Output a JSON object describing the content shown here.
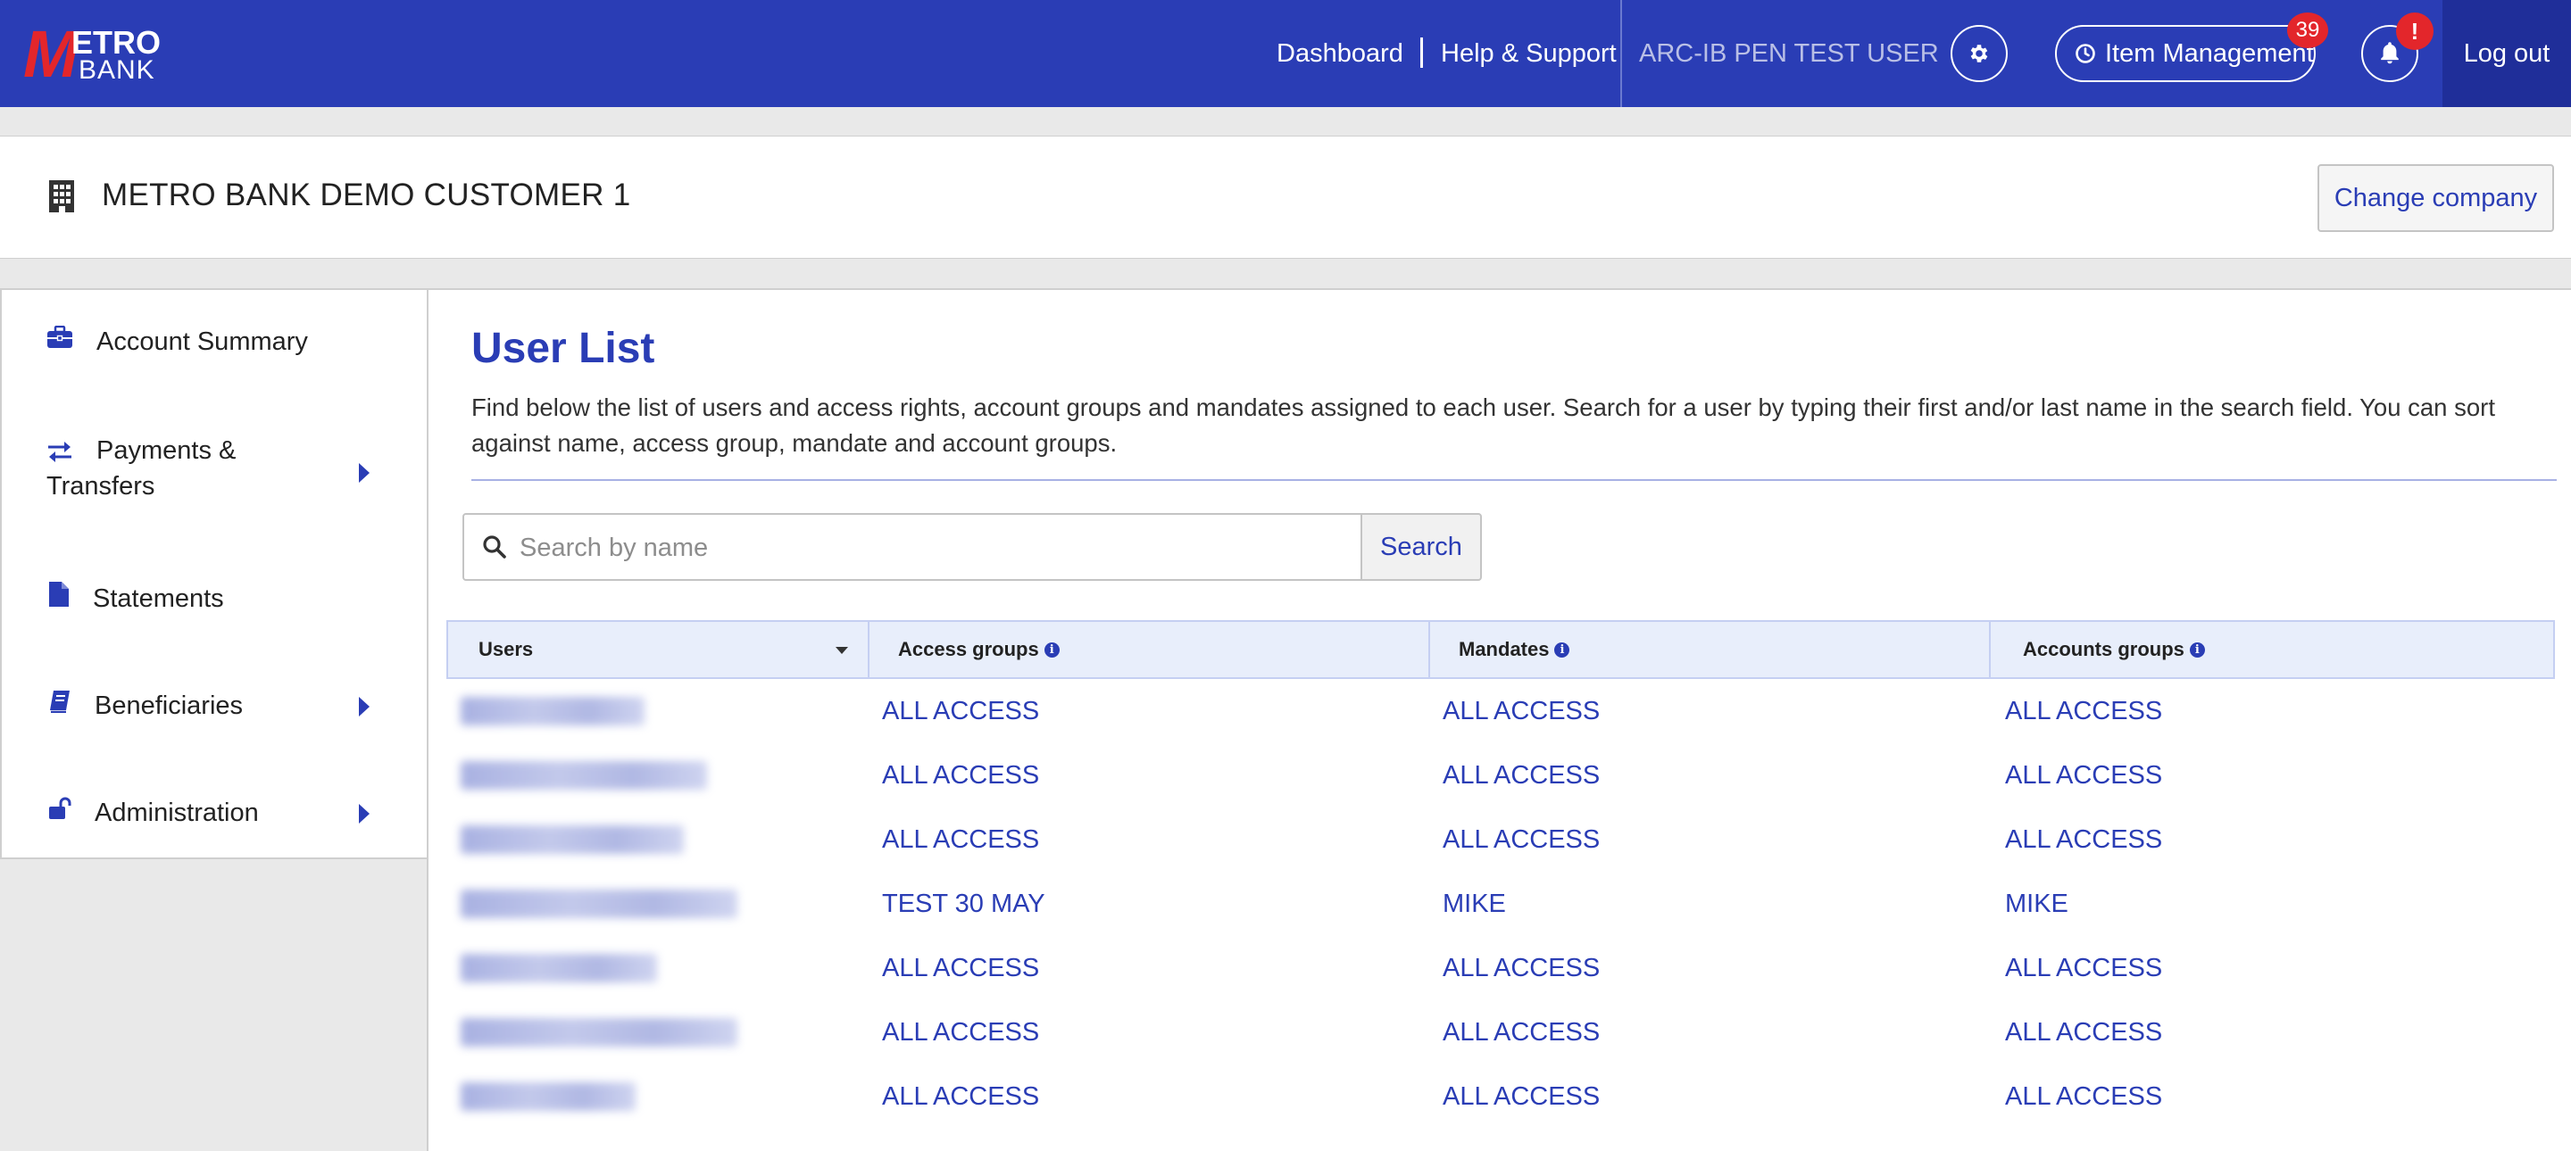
{
  "brand": {
    "logo_m": "M",
    "logo_etro": "ETRO",
    "logo_bank": "BANK",
    "primary_color": "#2a3db5",
    "accent_color": "#e3262b"
  },
  "topnav": {
    "dashboard": "Dashboard",
    "separator": "|",
    "help": "Help & Support",
    "user": "ARC-IB PEN TEST USER",
    "settings_icon": "gear-icon",
    "item_management": "Item Management",
    "item_management_icon": "clock-icon",
    "item_management_count": "39",
    "notifications_icon": "bell-icon",
    "notifications_badge": "!",
    "logout": "Log out"
  },
  "company": {
    "icon": "building-icon",
    "name": "METRO BANK DEMO CUSTOMER 1",
    "change_button": "Change company"
  },
  "sidebar": {
    "items": [
      {
        "label": "Account Summary",
        "icon": "briefcase-icon",
        "has_submenu": false
      },
      {
        "label": "Payments & Transfers",
        "icon": "transfer-arrows-icon",
        "has_submenu": true
      },
      {
        "label": "Statements",
        "icon": "document-icon",
        "has_submenu": false
      },
      {
        "label": "Beneficiaries",
        "icon": "address-book-icon",
        "has_submenu": true
      },
      {
        "label": "Administration",
        "icon": "unlock-icon",
        "has_submenu": true
      }
    ]
  },
  "main": {
    "title": "User List",
    "description": "Find below the list of users and access rights, account groups and mandates assigned to each user. Search for a user by typing their first and/or last name in the search field. You can sort against name, access group, mandate and account groups.",
    "search": {
      "placeholder": "Search by name",
      "value": "",
      "button": "Search",
      "icon": "search-icon"
    },
    "table": {
      "columns": [
        "Users",
        "Access groups",
        "Mandates",
        "Accounts groups"
      ],
      "info_icon": "i",
      "rows": [
        {
          "access": "ALL ACCESS",
          "mandate": "ALL ACCESS",
          "accounts": "ALL ACCESS"
        },
        {
          "access": "ALL ACCESS",
          "mandate": "ALL ACCESS",
          "accounts": "ALL ACCESS"
        },
        {
          "access": "ALL ACCESS",
          "mandate": "ALL ACCESS",
          "accounts": "ALL ACCESS"
        },
        {
          "access": "TEST 30 MAY",
          "mandate": "MIKE",
          "accounts": "MIKE"
        },
        {
          "access": "ALL ACCESS",
          "mandate": "ALL ACCESS",
          "accounts": "ALL ACCESS"
        },
        {
          "access": "ALL ACCESS",
          "mandate": "ALL ACCESS",
          "accounts": "ALL ACCESS"
        },
        {
          "access": "ALL ACCESS",
          "mandate": "ALL ACCESS",
          "accounts": "ALL ACCESS"
        }
      ]
    }
  }
}
